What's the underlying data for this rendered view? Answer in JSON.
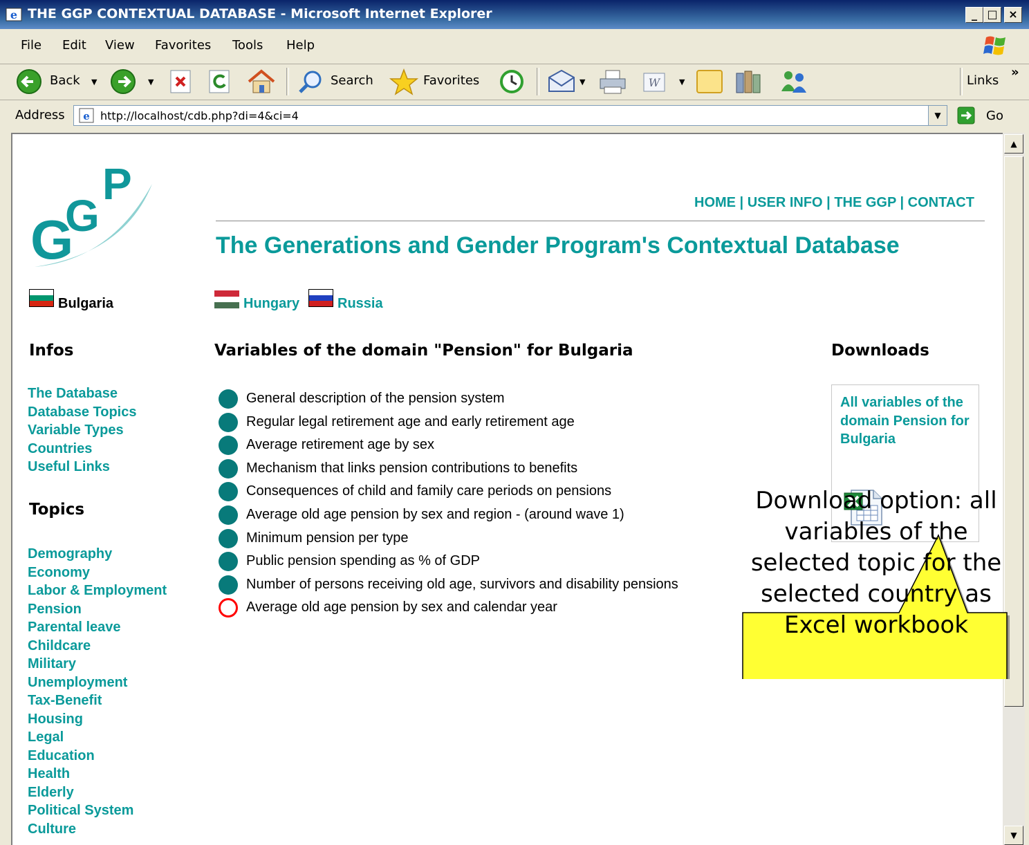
{
  "window": {
    "title": "THE GGP CONTEXTUAL DATABASE - Microsoft Internet Explorer",
    "buttons": {
      "minimize": "_",
      "maximize": "□",
      "close": "×"
    }
  },
  "menu": [
    "File",
    "Edit",
    "View",
    "Favorites",
    "Tools",
    "Help"
  ],
  "toolbar": {
    "back": "Back",
    "search": "Search",
    "favorites": "Favorites",
    "links": "Links",
    "more": "»"
  },
  "address": {
    "label": "Address",
    "url": "http://localhost/cdb.php?di=4&ci=4",
    "go": "Go"
  },
  "page": {
    "topnav": "HOME | USER INFO | THE GGP | CONTACT",
    "title": "The Generations and Gender Program's Contextual Database",
    "selected_country": "Bulgaria",
    "other_countries": [
      "Hungary",
      "Russia"
    ],
    "infos_heading": "Infos",
    "infos": [
      "The Database",
      "Database Topics",
      "Variable Types",
      "Countries",
      "Useful Links"
    ],
    "topics_heading": "Topics",
    "topics": [
      "Demography",
      "Economy",
      "Labor & Employment",
      "Pension",
      "Parental leave",
      "Childcare",
      "Military",
      "Unemployment",
      "Tax-Benefit",
      "Housing",
      "Legal",
      "Education",
      "Health",
      "Elderly",
      "Political System",
      "Culture"
    ],
    "variables_heading": "Variables of the domain \"Pension\" for Bulgaria",
    "variables": [
      {
        "label": "General description of the pension system",
        "filled": true
      },
      {
        "label": "Regular legal retirement age and early retirement age",
        "filled": true
      },
      {
        "label": "Average retirement age by sex",
        "filled": true
      },
      {
        "label": "Mechanism that links pension contributions to benefits",
        "filled": true
      },
      {
        "label": "Consequences of child and family care periods on pensions",
        "filled": true
      },
      {
        "label": "Average old age pension by sex and region - (around wave 1)",
        "filled": true
      },
      {
        "label": "Minimum pension per type",
        "filled": true
      },
      {
        "label": "Public pension spending as % of GDP",
        "filled": true
      },
      {
        "label": "Number of persons receiving old age, survivors and disability pensions",
        "filled": true
      },
      {
        "label": "Average old age pension by sex and calendar year",
        "filled": false
      }
    ],
    "downloads_heading": "Downloads",
    "download_link": "All variables of the domain Pension for Bulgaria"
  },
  "callout": {
    "text": "Download option: all variables of the selected topic for the selected country as Excel workbook"
  }
}
